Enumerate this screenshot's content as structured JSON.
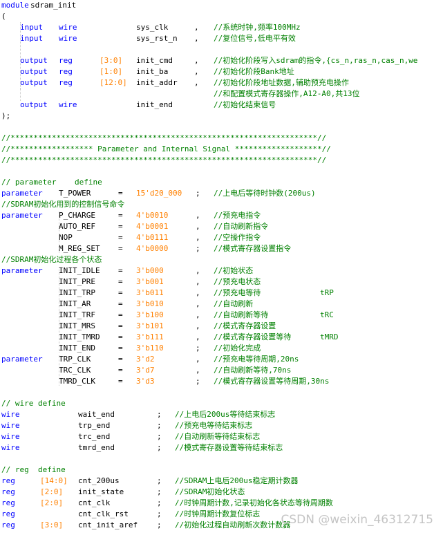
{
  "lines": [
    [
      "module",
      "sdram_init"
    ],
    [
      "("
    ],
    [
      "input",
      "wire",
      "sys_clk",
      ",",
      "//系统时钟,频率100MHz"
    ],
    [
      "input",
      "wire",
      "sys_rst_n",
      ",",
      "//复位信号,低电平有效"
    ],
    [],
    [
      "output",
      "reg",
      "[3:0]",
      "init_cmd",
      ",",
      "//初始化阶段写入sdram的指令,{cs_n,ras_n,cas_n,we"
    ],
    [
      "output",
      "reg",
      "[1:0]",
      "init_ba",
      ",",
      "//初始化阶段Bank地址"
    ],
    [
      "output",
      "reg",
      "[12:0]",
      "init_addr",
      ",",
      "//初始化阶段地址数据,辅助预充电操作"
    ],
    [
      "//和配置模式寄存器操作,A12-A0,共13位"
    ],
    [
      "output",
      "wire",
      "init_end",
      "//初始化结束信号"
    ],
    [
      ");"
    ],
    [],
    [
      "//*******************************************************************//"
    ],
    [
      "//****************** Parameter and Internal Signal *******************//"
    ],
    [
      "//*******************************************************************//"
    ],
    [],
    [
      "// parameter    define"
    ],
    [
      "parameter",
      "T_POWER",
      "=",
      "15'd20_000",
      ";",
      "//上电后等待时钟数(200us)"
    ],
    [
      "//SDRAM初始化用到的控制信号命令"
    ],
    [
      "parameter",
      "P_CHARGE",
      "=",
      "4'b0010",
      ",",
      "//预充电指令"
    ],
    [
      "AUTO_REF",
      "=",
      "4'b0001",
      ",",
      "//自动刷新指令"
    ],
    [
      "NOP",
      "=",
      "4'b0111",
      ",",
      "//空操作指令"
    ],
    [
      "M_REG_SET",
      "=",
      "4'b0000",
      ";",
      "//模式寄存器设置指令"
    ],
    [
      "//SDRAM初始化过程各个状态"
    ],
    [
      "parameter",
      "INIT_IDLE",
      "=",
      "3'b000",
      ",",
      "//初始状态"
    ],
    [
      "INIT_PRE",
      "=",
      "3'b001",
      ",",
      "//预充电状态"
    ],
    [
      "INIT_TRP",
      "=",
      "3'b011",
      ",",
      "//预充电等待",
      "tRP"
    ],
    [
      "INIT_AR",
      "=",
      "3'b010",
      ",",
      "//自动刷新"
    ],
    [
      "INIT_TRF",
      "=",
      "3'b100",
      ",",
      "//自动刷新等待",
      "tRC"
    ],
    [
      "INIT_MRS",
      "=",
      "3'b101",
      ",",
      "//模式寄存器设置"
    ],
    [
      "INIT_TMRD",
      "=",
      "3'b111",
      ",",
      "//模式寄存器设置等待",
      "tMRD"
    ],
    [
      "INIT_END",
      "=",
      "3'b110",
      ";",
      "//初始化完成"
    ],
    [
      "parameter",
      "TRP_CLK",
      "=",
      "3'd2",
      ",",
      "//预充电等待周期,20ns"
    ],
    [
      "TRC_CLK",
      "=",
      "3'd7",
      ",",
      "//自动刷新等待,70ns"
    ],
    [
      "TMRD_CLK",
      "=",
      "3'd3",
      ";",
      "//模式寄存器设置等待周期,30ns"
    ],
    [],
    [
      "// wire define"
    ],
    [
      "wire",
      "wait_end",
      ";",
      "//上电后200us等待结束标志"
    ],
    [
      "wire",
      "trp_end",
      ";",
      "//预充电等待结束标志"
    ],
    [
      "wire",
      "trc_end",
      ";",
      "//自动刷新等待结束标志"
    ],
    [
      "wire",
      "tmrd_end",
      ";",
      "//模式寄存器设置等待结束标志"
    ],
    [],
    [
      "// reg  define"
    ],
    [
      "reg",
      "[14:0]",
      "cnt_200us",
      ";",
      "//SDRAM上电后200us稳定期计数器"
    ],
    [
      "reg",
      "[2:0]",
      "init_state",
      ";",
      "//SDRAM初始化状态"
    ],
    [
      "reg",
      "[2:0]",
      "cnt_clk",
      ";",
      "//时钟周期计数,记录初始化各状态等待周期数"
    ],
    [
      "reg",
      "cnt_clk_rst",
      ";",
      "//时钟周期计数复位标志"
    ],
    [
      "reg",
      "[3:0]",
      "cnt_init_aref",
      ";",
      "//初始化过程自动刷新次数计数器"
    ]
  ],
  "watermark": "CSDN @weixin_46312715",
  "colors": {
    "keyword": "#0000ff",
    "number": "#ff8000",
    "comment": "#008000",
    "text": "#000000",
    "background": "#ffffff"
  }
}
